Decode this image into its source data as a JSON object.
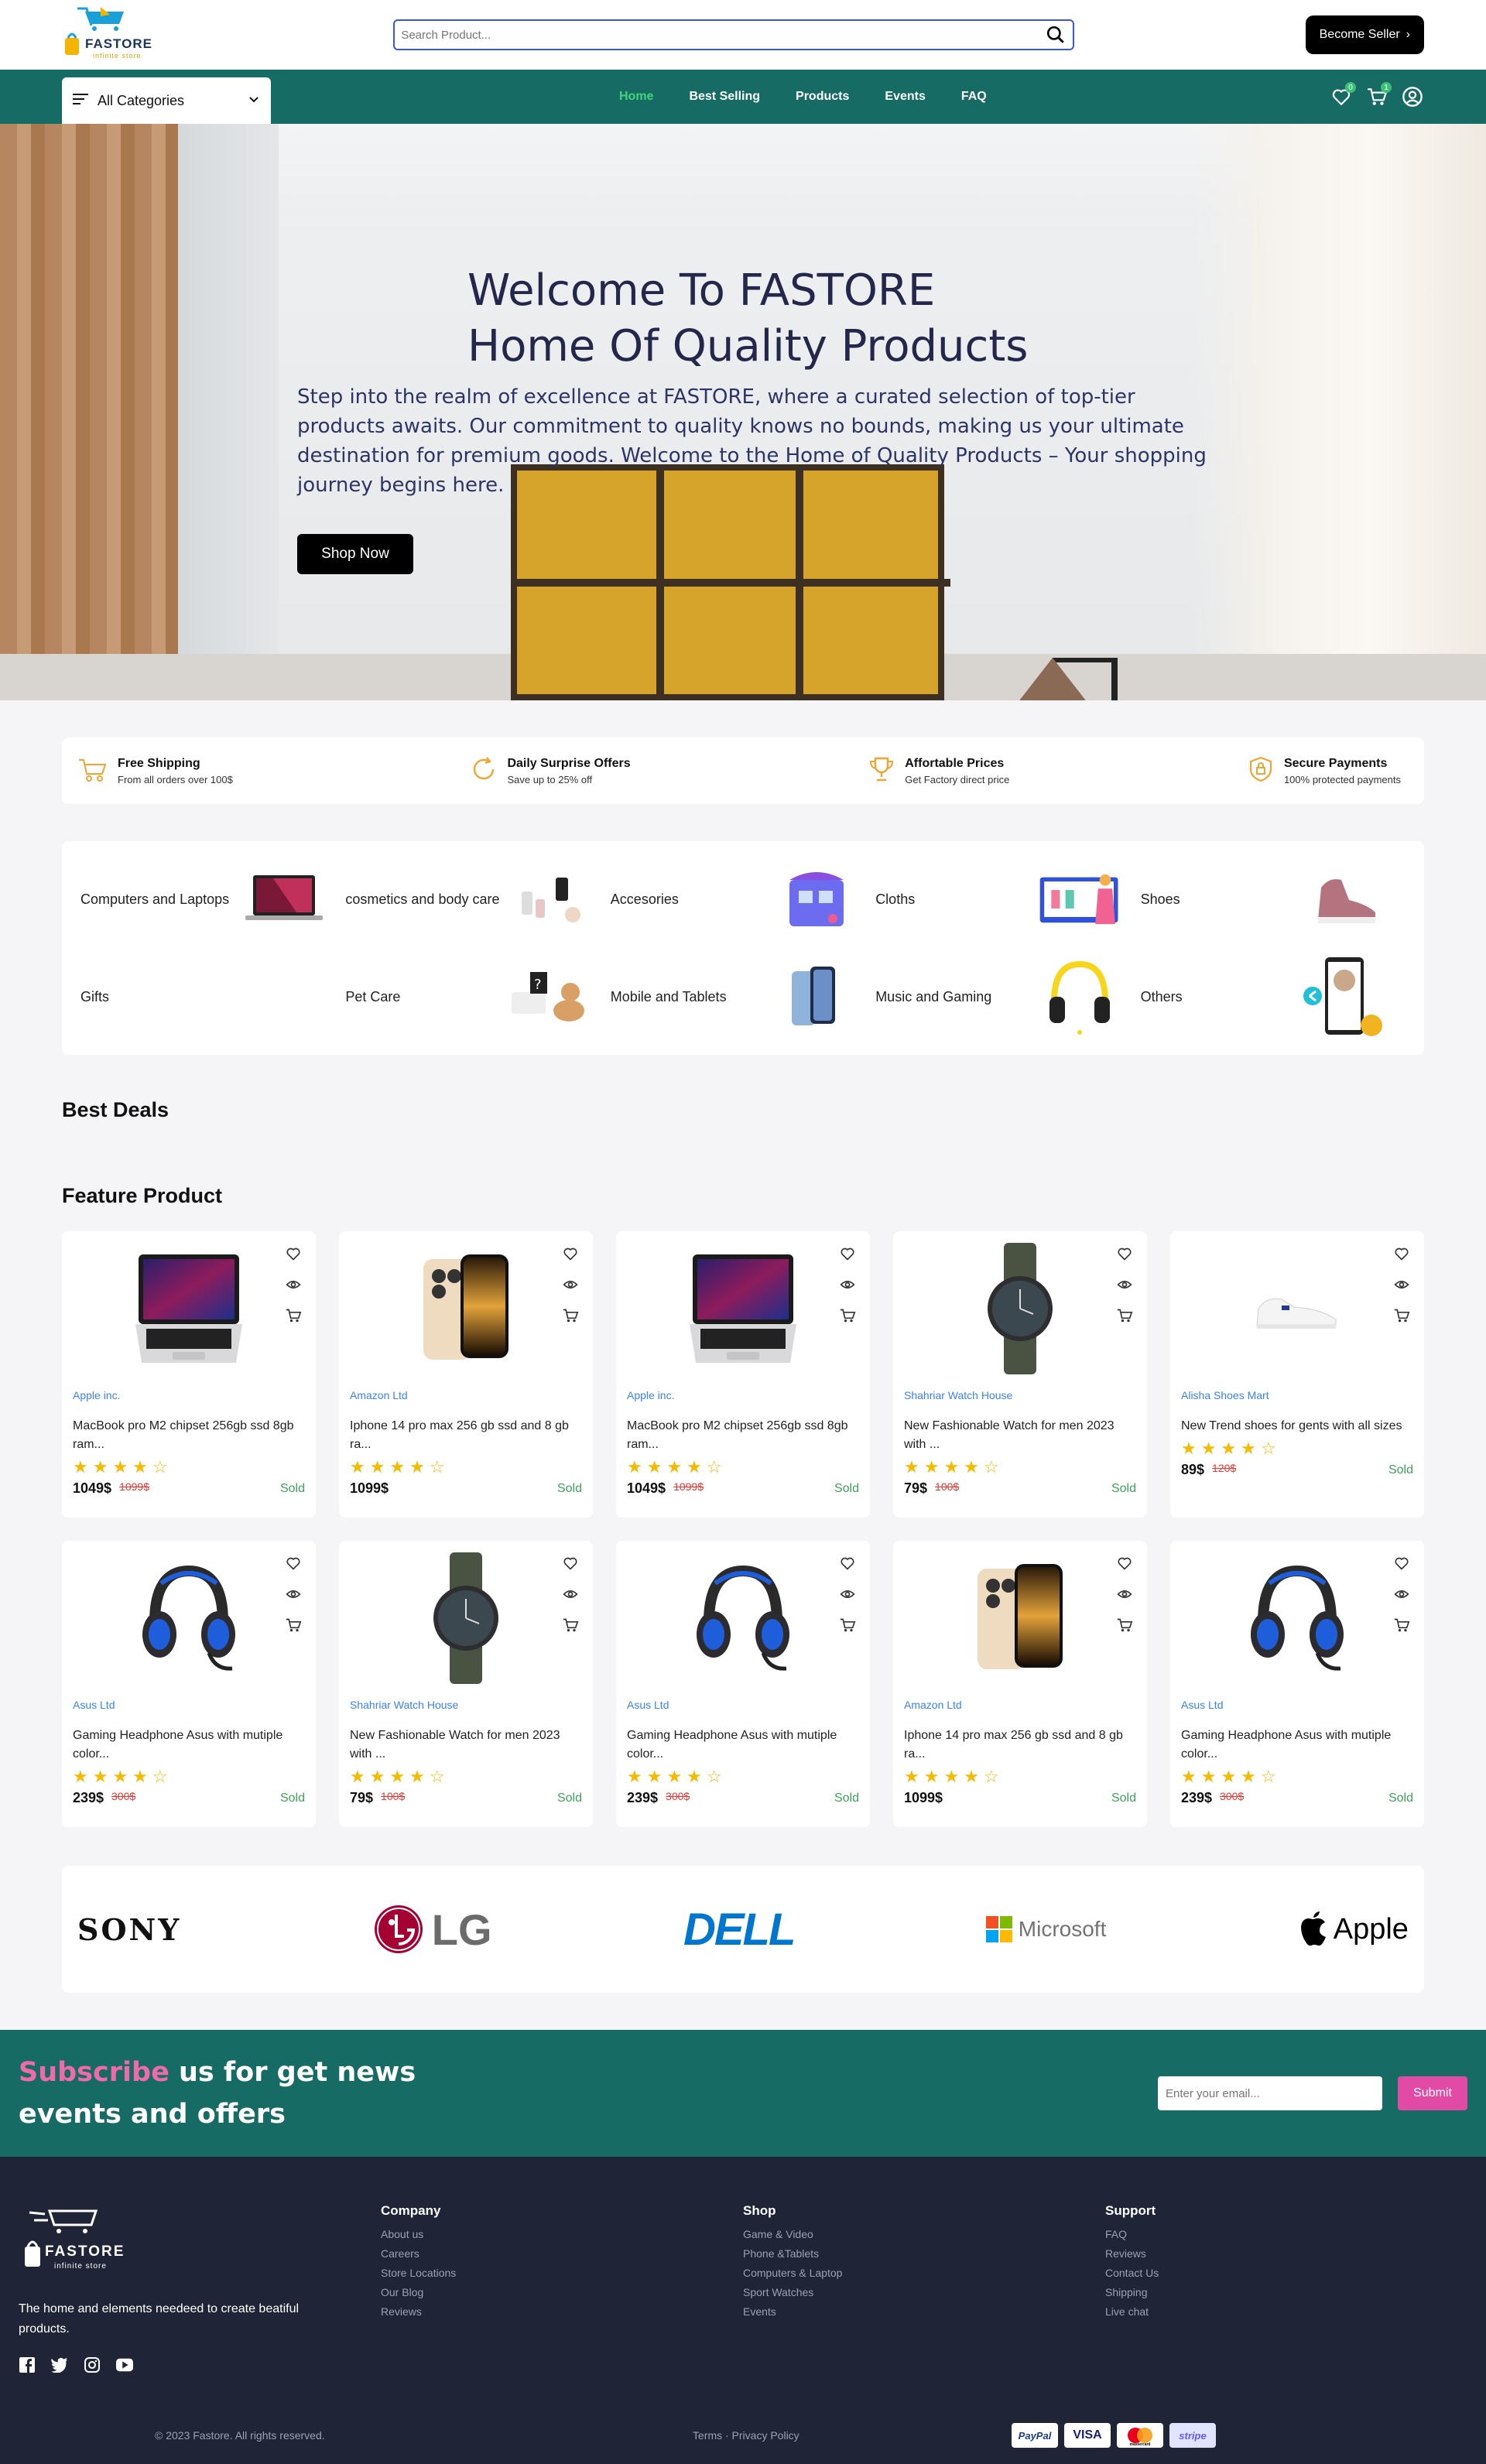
{
  "header": {
    "logo_text": "FASTORE",
    "logo_tagline": "infinite store",
    "search_placeholder": "Search Product...",
    "become_seller": "Become Seller"
  },
  "nav": {
    "all_categories": "All Categories",
    "links": [
      "Home",
      "Best Selling",
      "Products",
      "Events",
      "FAQ"
    ],
    "wishlist_count": "0",
    "cart_count": "1",
    "accent": "#176b65"
  },
  "hero": {
    "title_line1": "Welcome To FASTORE",
    "title_line2": "Home Of Quality Products",
    "description": "Step into the realm of excellence at FASTORE, where a curated selection of top-tier products awaits. Our commitment to quality knows no bounds, making us your ultimate destination for premium goods. Welcome to the Home of Quality Products – Your shopping journey begins here.",
    "cta": "Shop Now"
  },
  "features": [
    {
      "title": "Free Shipping",
      "subtitle": "From all orders over 100$",
      "icon": "truck-icon"
    },
    {
      "title": "Daily Surprise Offers",
      "subtitle": "Save up to 25% off",
      "icon": "refresh-icon"
    },
    {
      "title": "Affortable Prices",
      "subtitle": "Get Factory direct price",
      "icon": "trophy-icon"
    },
    {
      "title": "Secure Payments",
      "subtitle": "100% protected payments",
      "icon": "shield-icon"
    }
  ],
  "categories": [
    {
      "name": "Computers and Laptops",
      "icon": "laptop-icon"
    },
    {
      "name": "cosmetics and body care",
      "icon": "cosmetics-icon"
    },
    {
      "name": "Accesories",
      "icon": "accessories-icon"
    },
    {
      "name": "Cloths",
      "icon": "cloths-icon"
    },
    {
      "name": "Shoes",
      "icon": "shoe-icon"
    },
    {
      "name": "Gifts",
      "icon": "gift-icon"
    },
    {
      "name": "Pet Care",
      "icon": "pet-icon"
    },
    {
      "name": "Mobile and Tablets",
      "icon": "phone-icon"
    },
    {
      "name": "Music and Gaming",
      "icon": "headphone-icon"
    },
    {
      "name": "Others",
      "icon": "others-icon"
    }
  ],
  "sections": {
    "best_deals": "Best Deals",
    "feature_product": "Feature Product"
  },
  "products": [
    {
      "shop": "Apple inc.",
      "name": "MacBook pro M2 chipset 256gb ssd 8gb ram...",
      "price": "1049$",
      "old_price": "1099$",
      "sold": "Sold",
      "rating": 4,
      "img": "laptop"
    },
    {
      "shop": "Amazon Ltd",
      "name": "Iphone 14 pro max 256 gb ssd and 8 gb ra...",
      "price": "1099$",
      "old_price": "",
      "sold": "Sold",
      "rating": 4,
      "img": "phone"
    },
    {
      "shop": "Apple inc.",
      "name": "MacBook pro M2 chipset 256gb ssd 8gb ram...",
      "price": "1049$",
      "old_price": "1099$",
      "sold": "Sold",
      "rating": 4,
      "img": "laptop"
    },
    {
      "shop": "Shahriar Watch House",
      "name": "New Fashionable Watch for men 2023 with ...",
      "price": "79$",
      "old_price": "100$",
      "sold": "Sold",
      "rating": 4,
      "img": "watch"
    },
    {
      "shop": "Alisha Shoes Mart",
      "name": "New Trend shoes for gents with all sizes",
      "price": "89$",
      "old_price": "120$",
      "sold": "Sold",
      "rating": 4,
      "img": "shoe"
    },
    {
      "shop": "Asus Ltd",
      "name": "Gaming Headphone Asus with mutiple color...",
      "price": "239$",
      "old_price": "300$",
      "sold": "Sold",
      "rating": 4,
      "img": "headphone"
    },
    {
      "shop": "Shahriar Watch House",
      "name": "New Fashionable Watch for men 2023 with ...",
      "price": "79$",
      "old_price": "100$",
      "sold": "Sold",
      "rating": 4,
      "img": "watch"
    },
    {
      "shop": "Asus Ltd",
      "name": "Gaming Headphone Asus with mutiple color...",
      "price": "239$",
      "old_price": "300$",
      "sold": "Sold",
      "rating": 4,
      "img": "headphone"
    },
    {
      "shop": "Amazon Ltd",
      "name": "Iphone 14 pro max 256 gb ssd and 8 gb ra...",
      "price": "1099$",
      "old_price": "",
      "sold": "Sold",
      "rating": 4,
      "img": "phone"
    },
    {
      "shop": "Asus Ltd",
      "name": "Gaming Headphone Asus with mutiple color...",
      "price": "239$",
      "old_price": "300$",
      "sold": "Sold",
      "rating": 4,
      "img": "headphone"
    }
  ],
  "brands": [
    "SONY",
    "LG",
    "DELL",
    "Microsoft",
    "Apple"
  ],
  "subscribe": {
    "highlight": "Subscribe",
    "rest_line1": " us for get news",
    "line2": "events and offers",
    "placeholder": "Enter your email...",
    "button": "Submit"
  },
  "footer": {
    "tagline": "The home and elements needeed to create beatiful products.",
    "columns": [
      {
        "title": "Company",
        "links": [
          "About us",
          "Careers",
          "Store Locations",
          "Our Blog",
          "Reviews"
        ]
      },
      {
        "title": "Shop",
        "links": [
          "Game & Video",
          "Phone &Tablets",
          "Computers & Laptop",
          "Sport Watches",
          "Events"
        ]
      },
      {
        "title": "Support",
        "links": [
          "FAQ",
          "Reviews",
          "Contact Us",
          "Shipping",
          "Live chat"
        ]
      }
    ],
    "copyright": "© 2023 Fastore. All rights reserved.",
    "terms": "Terms · Privacy Policy",
    "payments": [
      "PayPal",
      "VISA",
      "mastercard",
      "stripe"
    ]
  }
}
